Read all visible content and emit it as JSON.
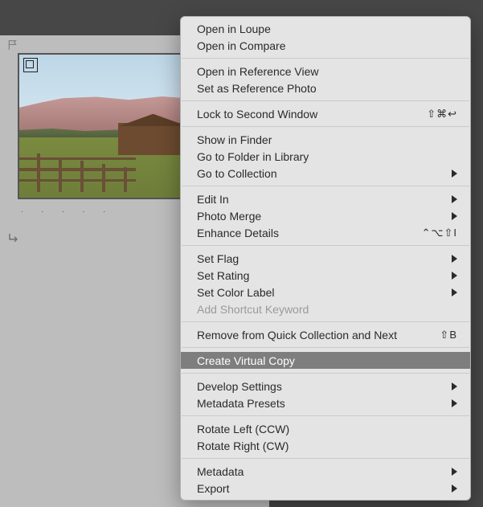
{
  "thumbnail": {
    "dots": ". . . . ."
  },
  "menu": {
    "open_loupe": "Open in Loupe",
    "open_compare": "Open in Compare",
    "open_reference": "Open in Reference View",
    "set_reference": "Set as Reference Photo",
    "lock_second_window": "Lock to Second Window",
    "lock_second_window_shortcut": "⇧⌘↩",
    "show_finder": "Show in Finder",
    "go_folder": "Go to Folder in Library",
    "go_collection": "Go to Collection",
    "edit_in": "Edit In",
    "photo_merge": "Photo Merge",
    "enhance_details": "Enhance Details",
    "enhance_details_shortcut": "⌃⌥⇧I",
    "set_flag": "Set Flag",
    "set_rating": "Set Rating",
    "set_color_label": "Set Color Label",
    "add_shortcut_keyword": "Add Shortcut Keyword",
    "remove_quick_collection": "Remove from Quick Collection and Next",
    "remove_quick_collection_shortcut": "⇧B",
    "create_virtual_copy": "Create Virtual Copy",
    "develop_settings": "Develop Settings",
    "metadata_presets": "Metadata Presets",
    "rotate_left": "Rotate Left (CCW)",
    "rotate_right": "Rotate Right (CW)",
    "metadata": "Metadata",
    "export": "Export"
  }
}
